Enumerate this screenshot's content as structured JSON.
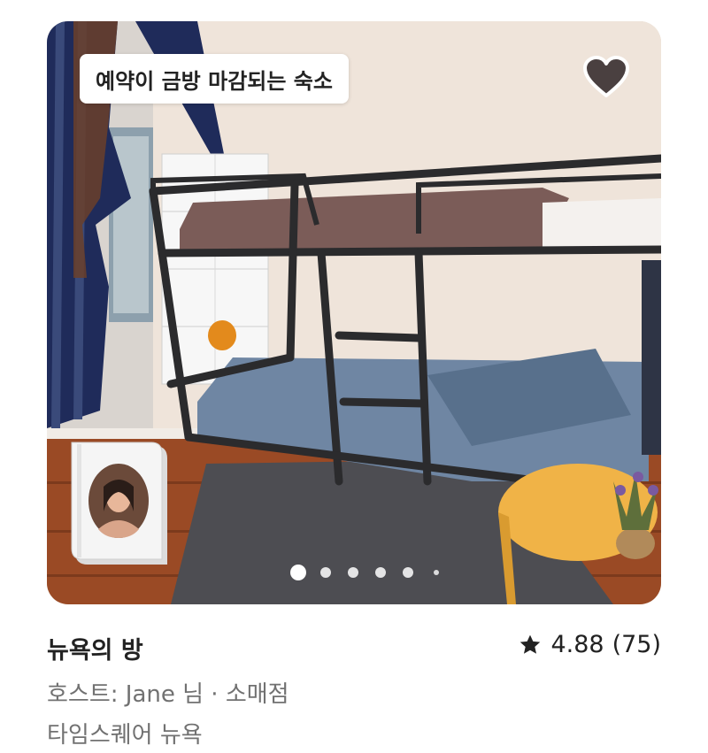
{
  "listing": {
    "badge": "예약이 금방 마감되는 숙소",
    "title": "뉴욕의 방",
    "rating": "4.88",
    "review_count": "(75)",
    "host_line": "호스트: Jane 님 · 소매점",
    "location": "타임스퀘어 뉴욕",
    "photo_count": 6,
    "active_photo_index": 1
  },
  "icons": {
    "favorite": "heart-icon",
    "rating": "star-icon",
    "host": "host-avatar"
  },
  "colors": {
    "text_primary": "#222222",
    "text_secondary": "#717171",
    "heart_fill": "#4a4040",
    "badge_bg": "#ffffff"
  }
}
